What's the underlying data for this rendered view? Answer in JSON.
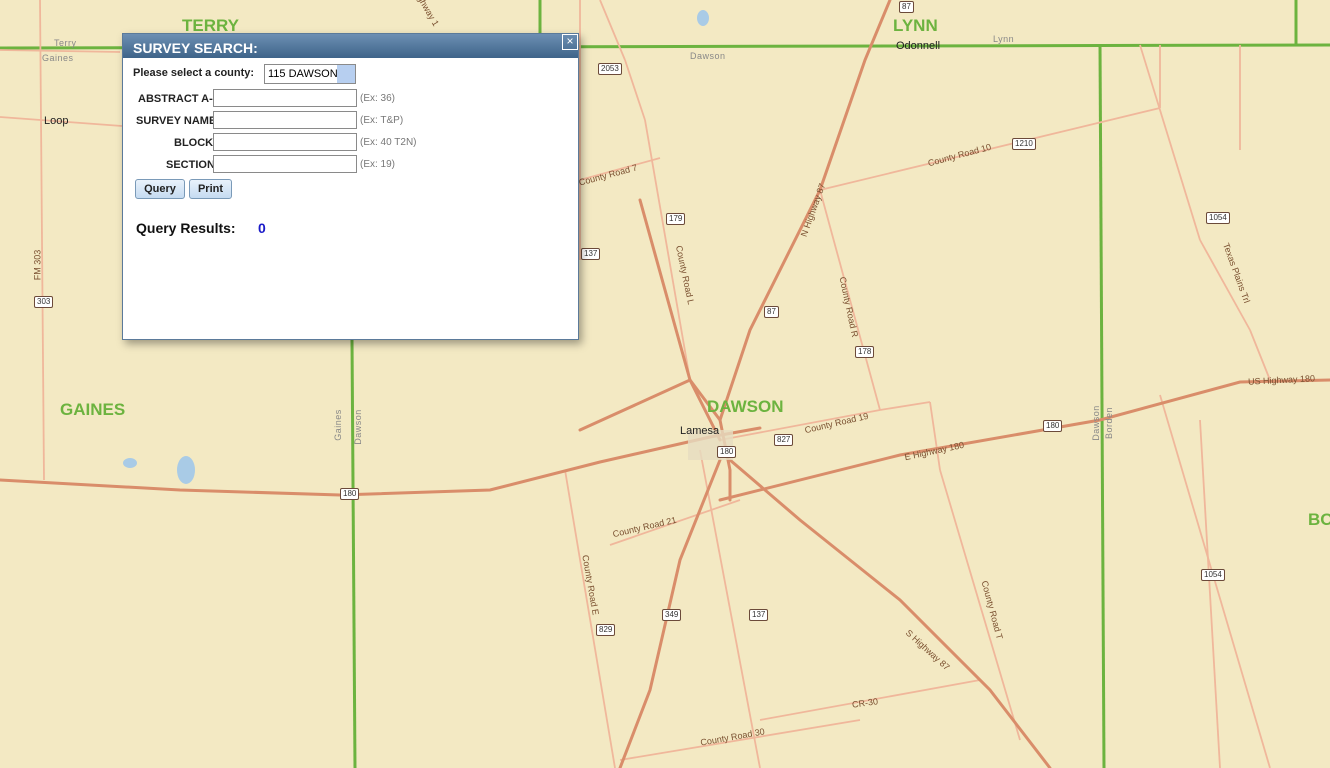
{
  "map": {
    "counties": {
      "terry": "TERRY",
      "lynn": "LYNN",
      "gaines": "GAINES",
      "dawson": "DAWSON",
      "borden_partial": "BO"
    },
    "small_labels": {
      "terry": "Terry",
      "gaines_top": "Gaines",
      "dawson_top": "Dawson",
      "lynn_small": "Lynn",
      "gaines_vert": "Gaines",
      "dawson_vert": "Dawson",
      "dawson_right_vert": "Dawson",
      "borden_vert": "Borden"
    },
    "cities": {
      "loop": "Loop",
      "odonnell": "Odonnell",
      "lamesa": "Lamesa"
    },
    "roads": {
      "county_road_7": "County Road 7",
      "county_road_l": "County Road L",
      "n_highway_87": "N Highway 87",
      "county_road_r": "County Road R",
      "county_road_10": "County Road 10",
      "county_road_19": "County Road 19",
      "e_highway_180": "E Highway 180",
      "us_highway_180": "US Highway 180",
      "county_road_21": "County Road 21",
      "county_road_e": "County Road E",
      "s_highway_87": "S Highway 87",
      "county_road_t": "County Road T",
      "cr_30": "CR-30",
      "county_road_30": "County Road 30",
      "texas_plains_trl": "Texas Plains Trl",
      "fm_303": "FM 303",
      "highway_top": "ighway 1"
    },
    "shields": {
      "s87_top": "87",
      "s2053": "2053",
      "s1210": "1210",
      "s179": "179",
      "s137_top": "137",
      "s1054_top": "1054",
      "s87": "87",
      "s178": "178",
      "s303": "303",
      "s180_right": "180",
      "s827": "827",
      "s180_lamesa": "180",
      "s180_left": "180",
      "s1054_bottom": "1054",
      "s349": "349",
      "s137": "137",
      "s829": "829"
    }
  },
  "dialog": {
    "title": "SURVEY SEARCH:",
    "county_label": "Please select a county:",
    "county_selected": "115 DAWSON",
    "fields": [
      {
        "label": "ABSTRACT A-",
        "value": "",
        "hint": "(Ex: 36)"
      },
      {
        "label": "SURVEY NAME",
        "value": "",
        "hint": "(Ex: T&P)"
      },
      {
        "label": "BLOCK",
        "value": "",
        "hint": "(Ex: 40 T2N)"
      },
      {
        "label": "SECTION",
        "value": "",
        "hint": "(Ex: 19)"
      }
    ],
    "query_button": "Query",
    "print_button": "Print",
    "results_label": "Query Results:",
    "results_count": "0",
    "close_glyph": "×"
  },
  "colors": {
    "county_line": "#6cb33f",
    "road": "#e9a885",
    "highway": "#d38a66",
    "annotation": "#1a1ac8",
    "dialog_title": "#4a6f96"
  }
}
